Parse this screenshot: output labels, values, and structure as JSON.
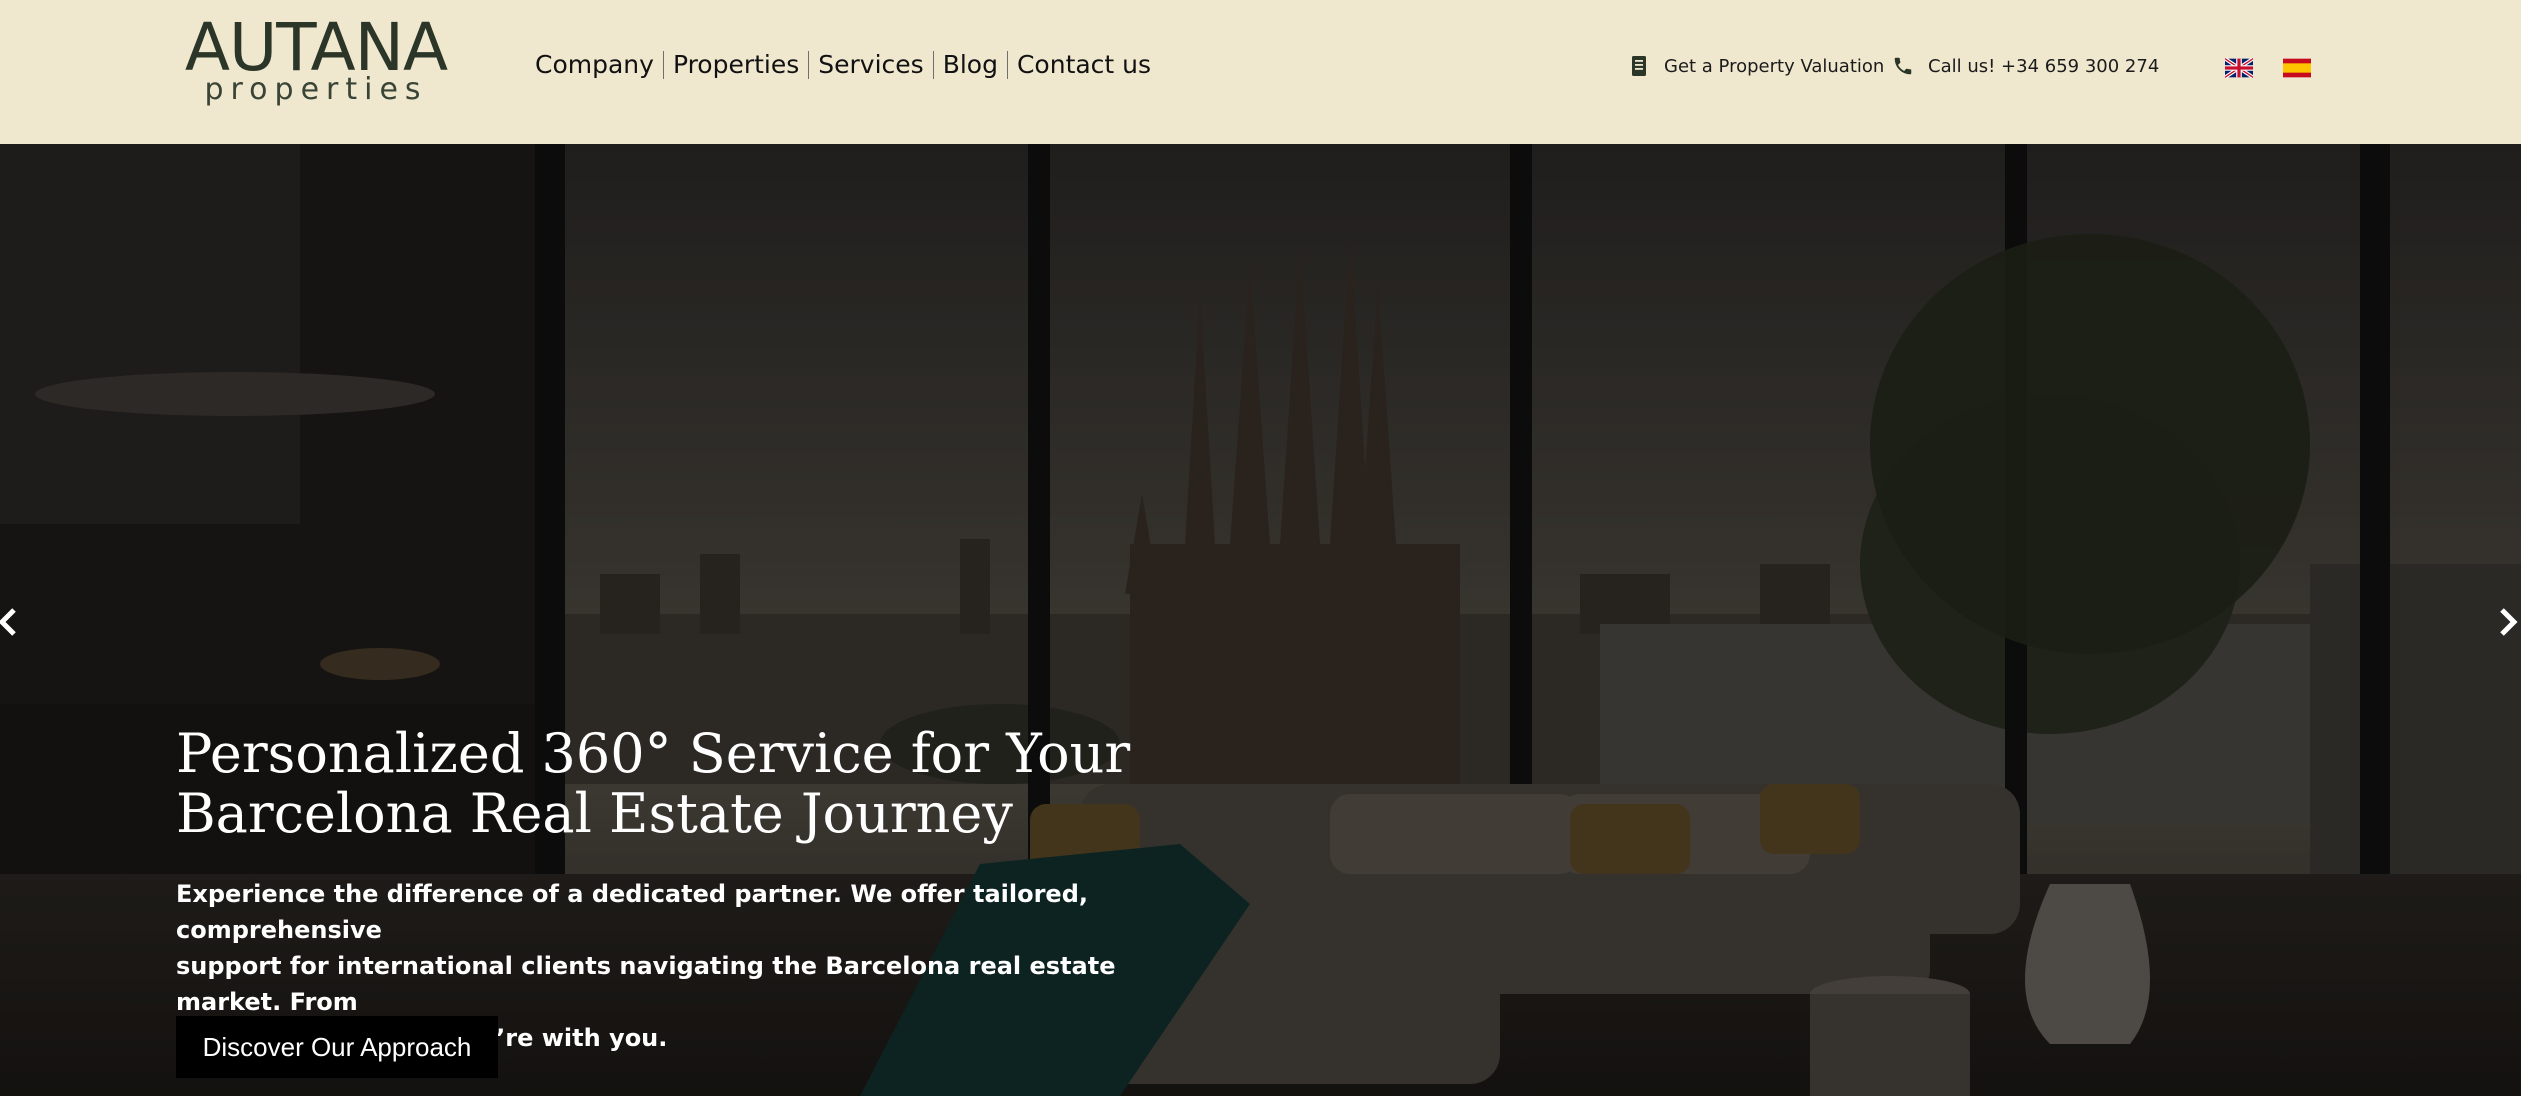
{
  "brand": {
    "name": "AUTANA",
    "tagline": "properties"
  },
  "nav": {
    "items": [
      {
        "label": "Company"
      },
      {
        "label": "Properties"
      },
      {
        "label": "Services"
      },
      {
        "label": "Blog"
      },
      {
        "label": "Contact us"
      }
    ]
  },
  "header_utils": {
    "valuation": {
      "label": "Get a Property Valuation",
      "icon": "document-icon"
    },
    "phone": {
      "label": "Call us! +34 659 300 274",
      "icon": "phone-icon"
    },
    "languages": [
      {
        "code": "en",
        "icon": "uk-flag-icon"
      },
      {
        "code": "es",
        "icon": "spain-flag-icon"
      }
    ]
  },
  "hero": {
    "title_lines": [
      "Personalized 360° Service for Your",
      "Barcelona Real Estate Journey"
    ],
    "text_lines": [
      "Experience the difference of a dedicated partner. We offer tailored, comprehensive",
      "support for international clients navigating the Barcelona real estate market. From",
      "search to signature, we’re with you."
    ],
    "cta_label": "Discover Our Approach",
    "prev_icon": "chevron-left-icon",
    "next_icon": "chevron-right-icon"
  },
  "colors": {
    "header_bg": "#efe8cf",
    "logo": "#2c3628",
    "cta_bg": "#000000",
    "hero_text": "#ffffff"
  }
}
